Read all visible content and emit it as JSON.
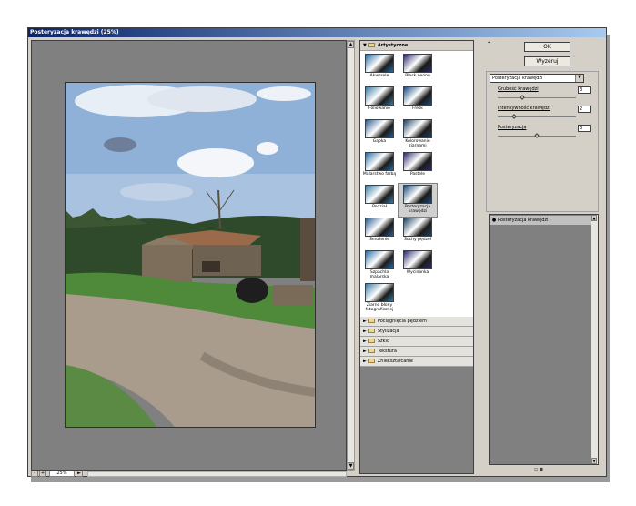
{
  "window": {
    "title": "Posteryzacja krawędzi (25%)"
  },
  "preview": {
    "zoom": "25%",
    "minus": "-",
    "plus": "+"
  },
  "scroll": {
    "up": "▲",
    "down": "▼",
    "left": "◄",
    "right": "►"
  },
  "gallery": {
    "open_category": "Artystyczne",
    "filters": [
      {
        "label": "Akwarele",
        "id": "akwarele"
      },
      {
        "label": "Blask neonu",
        "id": "blask-neonu"
      },
      {
        "label": "Foliowanie",
        "id": "foliowanie"
      },
      {
        "label": "Fresk",
        "id": "fresk"
      },
      {
        "label": "Gąbka",
        "id": "gabka"
      },
      {
        "label": "Kolorowanie ziarnami",
        "id": "kolorowanie-ziarnami"
      },
      {
        "label": "Malarstwo farbą",
        "id": "malarstwo-farba"
      },
      {
        "label": "Pastele",
        "id": "pastele"
      },
      {
        "label": "Podział",
        "id": "podzial"
      },
      {
        "label": "Posteryzacja krawędzi",
        "id": "posteryzacja-krawedzi"
      },
      {
        "label": "Smużenie",
        "id": "smuzenie"
      },
      {
        "label": "Suchy pędzel",
        "id": "suchy-pedzel"
      },
      {
        "label": "Szpachla malarska",
        "id": "szpachla-malarska"
      },
      {
        "label": "Wycinanka",
        "id": "wycinanka"
      },
      {
        "label": "Ziarno błony fotograficznej",
        "id": "ziarno-blony"
      }
    ],
    "selected_index": 9,
    "categories": [
      "Pociągnięcia pędzlem",
      "Stylizacja",
      "Szkic",
      "Tekstura",
      "Zniekształcanie"
    ]
  },
  "actions": {
    "ok": "OK",
    "reset": "Wyzeruj",
    "collapse": "⌃"
  },
  "settings": {
    "filter_select": "Posteryzacja krawędzi",
    "dropdown": "▼",
    "params": [
      {
        "label": "Grubość krawędzi",
        "value": "3",
        "fraction": 0.3
      },
      {
        "label": "Intensywność krawędzi",
        "value": "2",
        "fraction": 0.2
      },
      {
        "label": "Posteryzacja",
        "value": "3",
        "fraction": 0.5
      }
    ]
  },
  "layers": {
    "eye": "●",
    "active": "Posteryzacja krawędzi",
    "tools": "▫ ▪"
  },
  "colors": {
    "title_start": "#0a246a",
    "title_end": "#a6caf0",
    "panel": "#d4d0c8",
    "gray": "#808080"
  }
}
